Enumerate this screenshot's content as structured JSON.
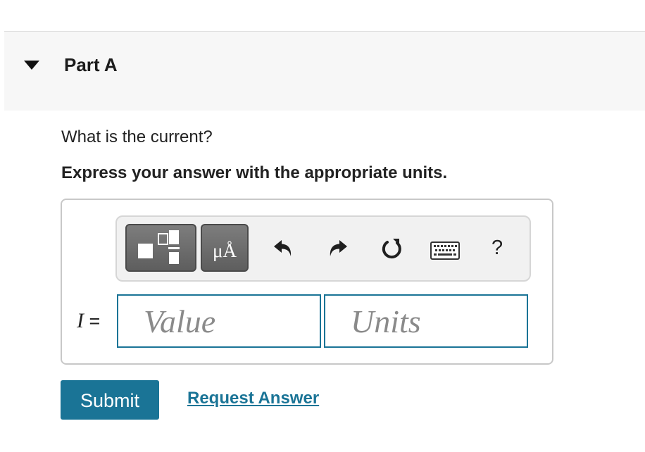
{
  "part": {
    "title": "Part A",
    "toggle_icon": "caret-down-icon"
  },
  "question": {
    "text": "What is the current?",
    "instruction": "Express your answer with the appropriate units."
  },
  "toolbar": {
    "templates_icon": "fraction-template-icon",
    "units_label": "μÅ",
    "undo_icon": "undo-arrow-icon",
    "redo_icon": "redo-arrow-icon",
    "reset_icon": "reset-circular-arrow-icon",
    "keyboard_icon": "keyboard-icon",
    "help_label": "?"
  },
  "answer": {
    "variable": "I",
    "equals": "=",
    "value_placeholder": "Value",
    "units_placeholder": "Units"
  },
  "actions": {
    "submit_label": "Submit",
    "request_answer_label": "Request Answer"
  },
  "colors": {
    "accent": "#1a7496",
    "header_background": "#f7f7f7",
    "toolbar_button": "#6b6b6b"
  }
}
